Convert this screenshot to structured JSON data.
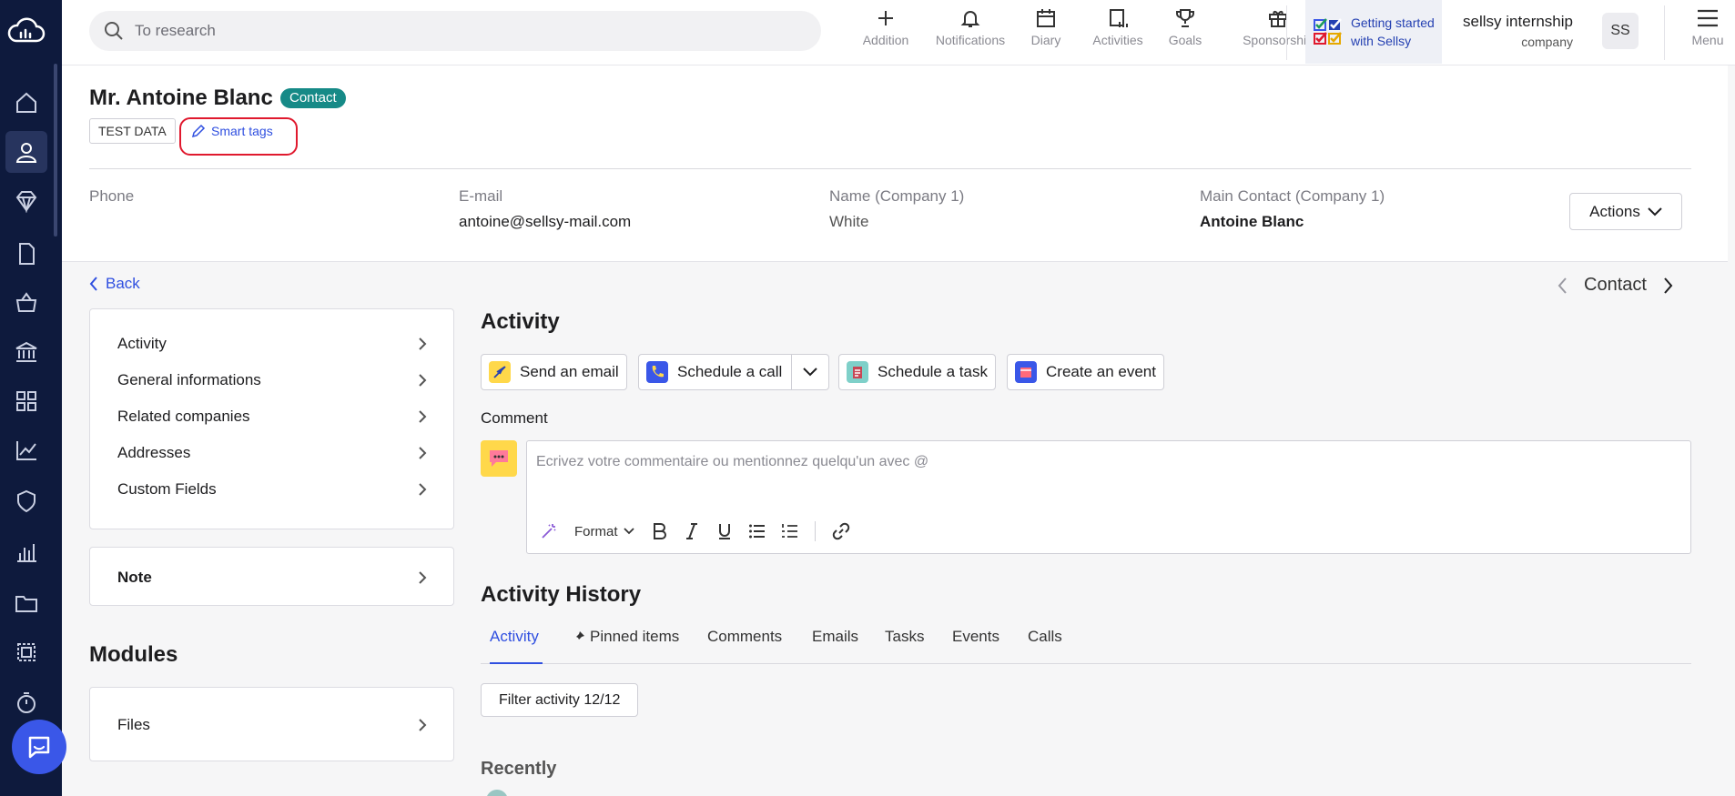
{
  "search": {
    "placeholder": "To research"
  },
  "toolbar": {
    "items": [
      {
        "label": "Addition",
        "icon": "plus-icon"
      },
      {
        "label": "Notifications",
        "icon": "bell-icon"
      },
      {
        "label": "Diary",
        "icon": "calendar-icon"
      },
      {
        "label": "Activities",
        "icon": "activities-icon"
      },
      {
        "label": "Goals",
        "icon": "trophy-icon"
      },
      {
        "label": "Sponsorship",
        "icon": "gift-icon"
      }
    ],
    "getting_started": "Getting started with Sellsy",
    "user_name": "sellsy internship",
    "user_company": "company",
    "avatar_initials": "SS",
    "menu_label": "Menu"
  },
  "contact": {
    "name": "Mr. Antoine Blanc",
    "badge": "Contact",
    "tag": "TEST DATA",
    "smart_tags": "Smart tags",
    "fields": [
      {
        "label": "Phone",
        "value": ""
      },
      {
        "label": "E-mail",
        "value": "antoine@sellsy-mail.com"
      },
      {
        "label": "Name (Company 1)",
        "value": "White"
      },
      {
        "label": "Main Contact (Company 1)",
        "value": "Antoine Blanc"
      }
    ],
    "actions_label": "Actions"
  },
  "nav": {
    "back": "Back",
    "pager_label": "Contact",
    "sections": [
      "Activity",
      "General informations",
      "Related companies",
      "Addresses",
      "Custom Fields"
    ],
    "note": "Note",
    "modules_title": "Modules",
    "files": "Files"
  },
  "activity": {
    "title": "Activity",
    "buttons": [
      "Send an email",
      "Schedule a call",
      "Schedule a task",
      "Create an event"
    ],
    "comment_label": "Comment",
    "comment_placeholder": "Ecrivez votre commentaire ou mentionnez quelqu'un avec @",
    "format_label": "Format"
  },
  "history": {
    "title": "Activity History",
    "tabs": [
      "Activity",
      "Pinned items",
      "Comments",
      "Emails",
      "Tasks",
      "Events",
      "Calls"
    ],
    "filter": "Filter activity 12/12",
    "recently": "Recently"
  },
  "colors": {
    "rail": "#0e1a3d",
    "accent": "#2f4fe0",
    "badge": "#168a87",
    "highlight_ring": "#e0192e"
  }
}
